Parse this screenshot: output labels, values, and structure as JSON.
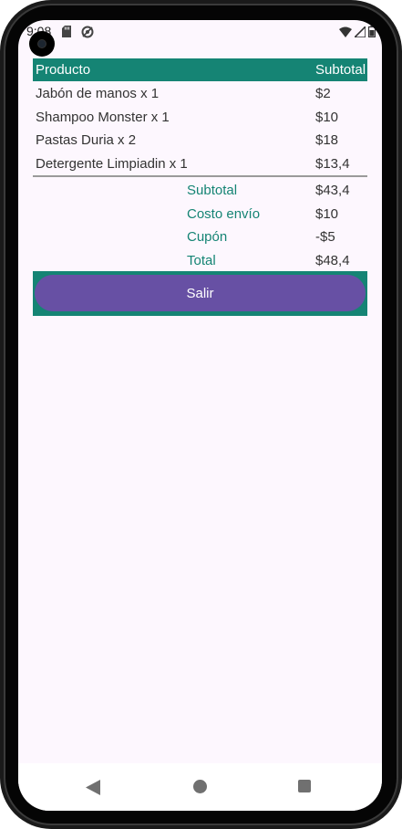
{
  "status_bar": {
    "time": "9:08"
  },
  "table": {
    "header": {
      "product": "Producto",
      "subtotal": "Subtotal"
    },
    "rows": [
      {
        "product": "Jabón de manos x 1",
        "subtotal": "$2"
      },
      {
        "product": "Shampoo Monster x 1",
        "subtotal": "$10"
      },
      {
        "product": "Pastas Duria x 2",
        "subtotal": "$18"
      },
      {
        "product": "Detergente Limpiadin x 1",
        "subtotal": "$13,4"
      }
    ]
  },
  "summary": {
    "subtotal_label": "Subtotal",
    "subtotal_value": "$43,4",
    "shipping_label": "Costo envío",
    "shipping_value": "$10",
    "coupon_label": "Cupón",
    "coupon_value": "-$5",
    "total_label": "Total",
    "total_value": "$48,4"
  },
  "actions": {
    "exit_label": "Salir"
  },
  "colors": {
    "accent": "#158474",
    "button": "#6750a4",
    "background": "#fdf7fe"
  },
  "icons": {
    "status_left": [
      "sd-card-icon",
      "sync-icon"
    ],
    "status_right": [
      "wifi-icon",
      "signal-icon",
      "battery-icon"
    ],
    "nav": [
      "back-icon",
      "home-icon",
      "recents-icon"
    ]
  }
}
